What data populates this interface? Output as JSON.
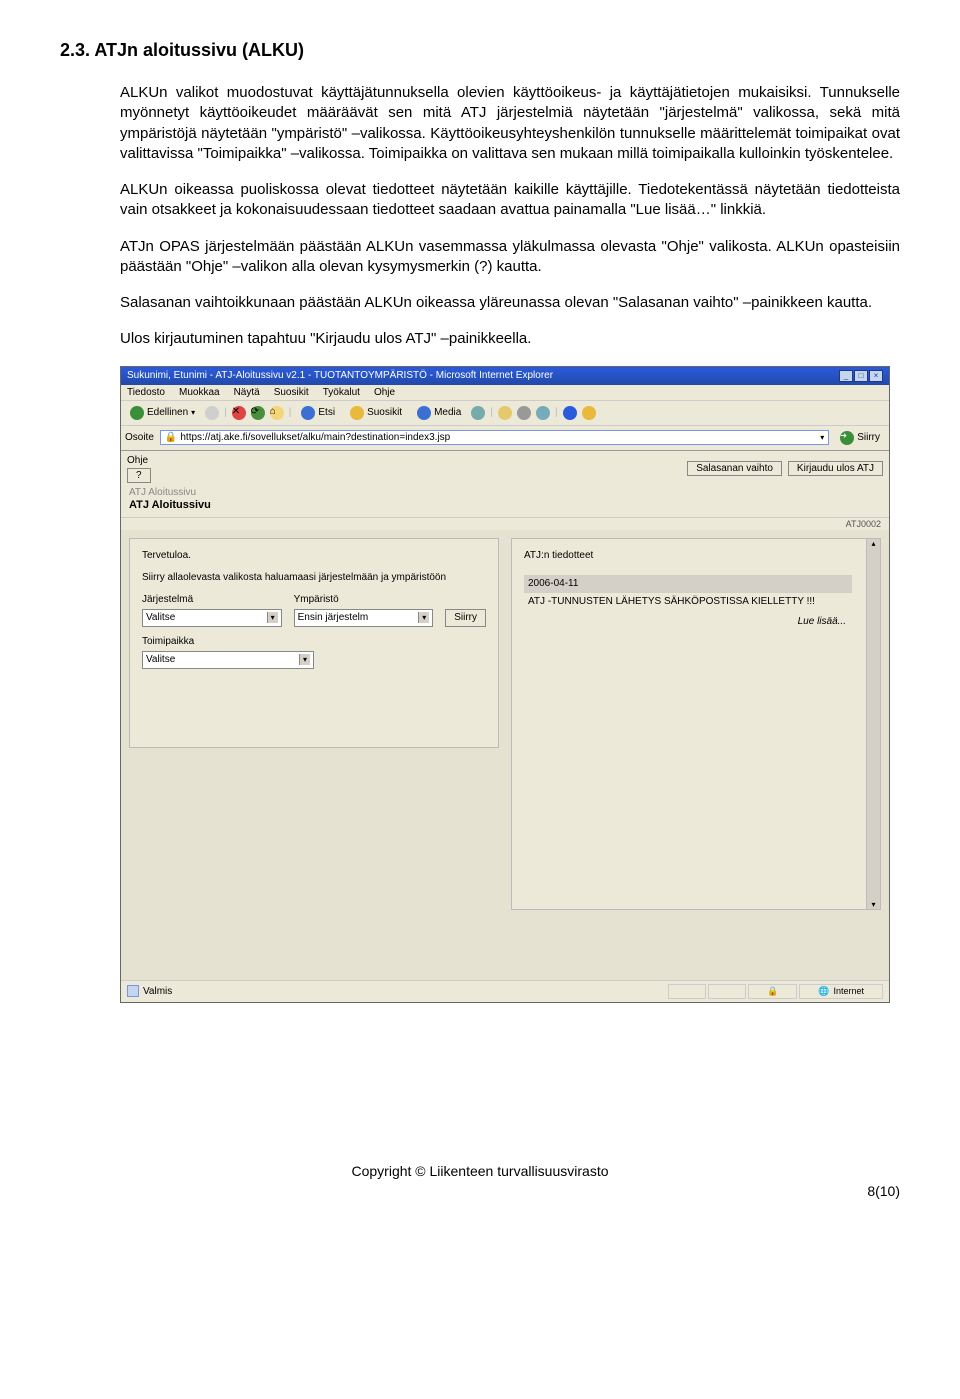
{
  "heading": "2.3. ATJn aloitussivu (ALKU)",
  "paragraphs": {
    "p1": "ALKUn valikot muodostuvat käyttäjätunnuksella olevien käyttöoikeus- ja käyttäjätietojen mukaisiksi. Tunnukselle myönnetyt käyttöoikeudet määräävät sen mitä ATJ järjestelmiä näytetään \"järjestelmä\" valikossa, sekä mitä ympäristöjä näytetään \"ympäristö\" –valikossa. Käyttöoikeusyhteyshenkilön tunnukselle määrittelemät toimipaikat ovat valittavissa \"Toimipaikka\" –valikossa. Toimipaikka on valittava sen mukaan millä toimipaikalla kulloinkin työskentelee.",
    "p2": "ALKUn oikeassa puoliskossa olevat tiedotteet näytetään kaikille käyttäjille. Tiedotekentässä näytetään tiedotteista vain otsakkeet ja kokonaisuudessaan tiedotteet saadaan avattua painamalla \"Lue lisää…\" linkkiä.",
    "p3": "ATJn OPAS järjestelmään päästään ALKUn vasemmassa yläkulmassa olevasta \"Ohje\" valikosta. ALKUn opasteisiin päästään \"Ohje\" –valikon alla olevan kysymysmerkin (?) kautta.",
    "p4": "Salasanan vaihtoikkunaan päästään ALKUn oikeassa yläreunassa olevan \"Salasanan vaihto\" –painikkeen kautta.",
    "p5": "Ulos kirjautuminen tapahtuu \"Kirjaudu ulos ATJ\" –painikkeella."
  },
  "browser": {
    "title": "Sukunimi, Etunimi - ATJ-Aloitussivu v2.1 - TUOTANTOYMPÄRISTÖ - Microsoft Internet Explorer",
    "menus": {
      "tiedosto": "Tiedosto",
      "muokkaa": "Muokkaa",
      "nayta": "Näytä",
      "suosikit": "Suosikit",
      "tyokalut": "Työkalut",
      "ohje": "Ohje"
    },
    "tb": {
      "edellinen": "Edellinen",
      "etsi": "Etsi",
      "suosikit": "Suosikit",
      "media": "Media"
    },
    "addr_label": "Osoite",
    "url": "https://atj.ake.fi/sovellukset/alku/main?destination=index3.jsp",
    "siirry": "Siirry",
    "status_left": "Valmis",
    "status_right": "Internet"
  },
  "app": {
    "ohje": "Ohje",
    "help_q": "?",
    "salasanan_vaihto": "Salasanan vaihto",
    "kirjaudu_ulos": "Kirjaudu ulos ATJ",
    "breadcrumb": "ATJ Aloitussivu",
    "title": "ATJ Aloitussivu",
    "code": "ATJ0002",
    "tervetuloa": "Tervetuloa.",
    "siirry_text": "Siirry allaolevasta valikosta haluamaasi järjestelmään ja ympäristöön",
    "jarjestelma_lbl": "Järjestelmä",
    "ymparisto_lbl": "Ympäristö",
    "jarjestelma_val": "Valitse",
    "ymparisto_val": "Ensin järjestelm",
    "siirry_btn": "Siirry",
    "toimipaikka_lbl": "Toimipaikka",
    "toimipaikka_val": "Valitse",
    "tiedotteet_title": "ATJ:n tiedotteet",
    "tiedote_date": "2006-04-11",
    "tiedote_text": "ATJ -TUNNUSTEN LÄHETYS SÄHKÖPOSTISSA KIELLETTY !!!",
    "lue_lisaa": "Lue lisää..."
  },
  "footer": {
    "copyright": "Copyright © Liikenteen turvallisuusvirasto",
    "pagenum": "8(10)"
  }
}
